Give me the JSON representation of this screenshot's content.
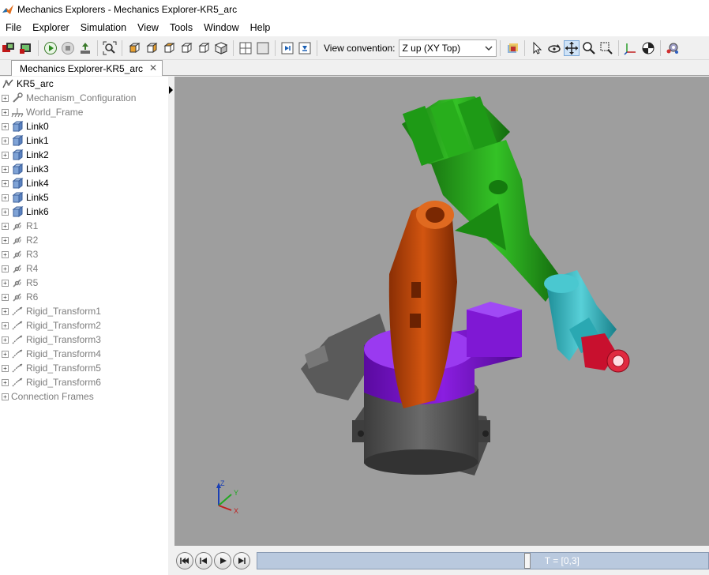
{
  "window": {
    "title": "Mechanics Explorers - Mechanics Explorer-KR5_arc"
  },
  "menu": [
    "File",
    "Explorer",
    "Simulation",
    "View",
    "Tools",
    "Window",
    "Help"
  ],
  "toolbar": {
    "view_convention_label": "View convention:",
    "view_convention_value": "Z up (XY Top)"
  },
  "tab": {
    "label": "Mechanics Explorer-KR5_arc",
    "close": "✕"
  },
  "tree": {
    "root": "KR5_arc",
    "items": [
      {
        "label": "Mechanism_Configuration",
        "icon": "wrench-icon",
        "dim": true
      },
      {
        "label": "World_Frame",
        "icon": "ground-icon",
        "dim": true
      },
      {
        "label": "Link0",
        "icon": "solid-cube-icon",
        "dim": false
      },
      {
        "label": "Link1",
        "icon": "solid-cube-icon",
        "dim": false
      },
      {
        "label": "Link2",
        "icon": "solid-cube-icon",
        "dim": false
      },
      {
        "label": "Link3",
        "icon": "solid-cube-icon",
        "dim": false
      },
      {
        "label": "Link4",
        "icon": "solid-cube-icon",
        "dim": false
      },
      {
        "label": "Link5",
        "icon": "solid-cube-icon",
        "dim": false
      },
      {
        "label": "Link6",
        "icon": "solid-cube-icon",
        "dim": false
      },
      {
        "label": "R1",
        "icon": "revolute-joint-icon",
        "dim": true
      },
      {
        "label": "R2",
        "icon": "revolute-joint-icon",
        "dim": true
      },
      {
        "label": "R3",
        "icon": "revolute-joint-icon",
        "dim": true
      },
      {
        "label": "R4",
        "icon": "revolute-joint-icon",
        "dim": true
      },
      {
        "label": "R5",
        "icon": "revolute-joint-icon",
        "dim": true
      },
      {
        "label": "R6",
        "icon": "revolute-joint-icon",
        "dim": true
      },
      {
        "label": "Rigid_Transform1",
        "icon": "rigid-transform-icon",
        "dim": true
      },
      {
        "label": "Rigid_Transform2",
        "icon": "rigid-transform-icon",
        "dim": true
      },
      {
        "label": "Rigid_Transform3",
        "icon": "rigid-transform-icon",
        "dim": true
      },
      {
        "label": "Rigid_Transform4",
        "icon": "rigid-transform-icon",
        "dim": true
      },
      {
        "label": "Rigid_Transform5",
        "icon": "rigid-transform-icon",
        "dim": true
      },
      {
        "label": "Rigid_Transform6",
        "icon": "rigid-transform-icon",
        "dim": true
      },
      {
        "label": "Connection Frames",
        "icon": "",
        "dim": true
      }
    ]
  },
  "axes_triad": {
    "z": "Z",
    "y": "Y",
    "x": "X"
  },
  "playback": {
    "time": "T = [0,3]",
    "progress": 0.6
  },
  "colors": {
    "viewport_bg": "#9e9e9e",
    "link_base": "#555555",
    "link_purple": "#7a10c8",
    "link_orange": "#c14a0a",
    "link_green": "#22a81a",
    "link_cyan": "#36bac4",
    "link_red": "#c8102e"
  }
}
